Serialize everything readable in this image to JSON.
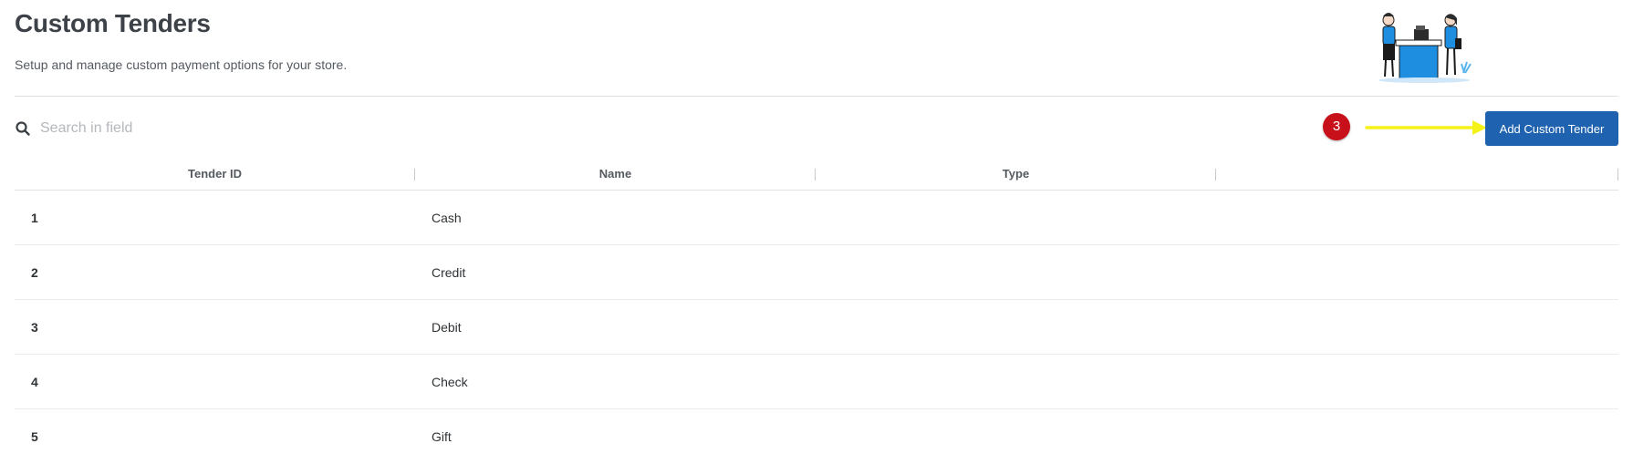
{
  "header": {
    "title": "Custom Tenders",
    "subtitle": "Setup and manage custom payment options for your store."
  },
  "toolbar": {
    "search_placeholder": "Search in field",
    "step_badge": "3",
    "add_button_label": "Add Custom Tender",
    "button_color": "#1f63b0",
    "badge_color": "#c8101a",
    "arrow_color": "#f5f21a"
  },
  "table": {
    "columns": [
      "Tender ID",
      "Name",
      "Type",
      ""
    ],
    "rows": [
      {
        "id": "1",
        "name": "Cash",
        "type": ""
      },
      {
        "id": "2",
        "name": "Credit",
        "type": ""
      },
      {
        "id": "3",
        "name": "Debit",
        "type": ""
      },
      {
        "id": "4",
        "name": "Check",
        "type": ""
      },
      {
        "id": "5",
        "name": "Gift",
        "type": ""
      }
    ]
  }
}
